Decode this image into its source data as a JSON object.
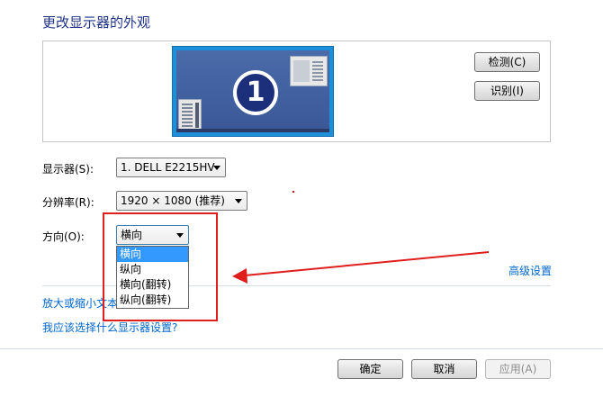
{
  "title": "更改显示器的外观",
  "preview": {
    "monitor_number": "1",
    "buttons": {
      "detect": "检测(C)",
      "identify": "识别(I)"
    }
  },
  "fields": {
    "display": {
      "label": "显示器(S):",
      "value": "1. DELL E2215HV"
    },
    "resolution": {
      "label": "分辨率(R):",
      "value": "1920 × 1080 (推荐)"
    },
    "orientation": {
      "label": "方向(O):",
      "value": "横向",
      "options": [
        "横向",
        "纵向",
        "横向(翻转)",
        "纵向(翻转)"
      ],
      "selected_index": 0
    }
  },
  "links": {
    "advanced": "高级设置",
    "text_size": "放大或缩小文本",
    "which_settings": "我应该选择什么显示器设置?"
  },
  "footer": {
    "ok": "确定",
    "cancel": "取消",
    "apply": "应用(A)"
  },
  "annotation": {
    "color": "#e01e1e"
  }
}
